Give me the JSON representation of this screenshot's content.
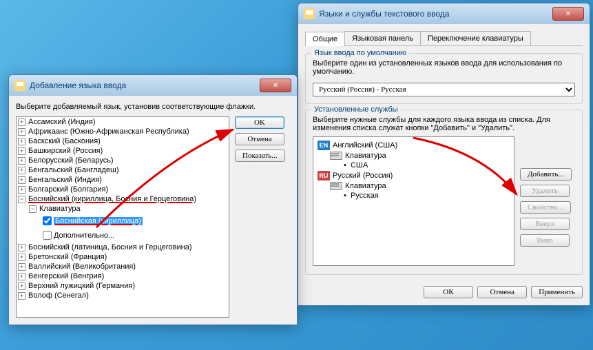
{
  "w1": {
    "title": "Добавление языка ввода",
    "instr": "Выберите добавляемый язык, установив соответствующие флажки.",
    "items": [
      "Ассамский (Индия)",
      "Африкаанс (Южно-Африканская Республика)",
      "Баскский (Баскония)",
      "Башкирский (Россия)",
      "Белорусский (Беларусь)",
      "Бенгальский (Бангладеш)",
      "Бенгальский (Индия)",
      "Болгарский (Болгария)"
    ],
    "open": "Боснийский (кириллица, Босния и Герцеговина)",
    "kb_lbl": "Клавиатура",
    "sel": "Боснийская (кириллица)",
    "extra": "Дополнительно...",
    "rest": [
      "Боснийский (латиница, Босния и Герцеговина)",
      "Бретонский (Франция)",
      "Валлийский (Великобритания)",
      "Венгерский (Венгрия)",
      "Верхний лужицкий (Германия)",
      "Волоф (Сенегал)"
    ],
    "ok": "OK",
    "cancel": "Отмена",
    "show": "Показать..."
  },
  "w2": {
    "title": "Языки и службы текстового ввода",
    "tabs": [
      "Общие",
      "Языковая панель",
      "Переключение клавиатуры"
    ],
    "fs1": {
      "legend": "Язык ввода по умолчанию",
      "text": "Выберите один из установленных языков ввода для использования по умолчанию.",
      "value": "Русский (Россия) - Русская"
    },
    "fs2": {
      "legend": "Установленные службы",
      "text": "Выберите нужные службы для каждого языка ввода из списка. Для изменения списка служат кнопки \"Добавить\" и \"Удалить\".",
      "en": "Английский (США)",
      "en_kb": "Клавиатура",
      "en_lay": "США",
      "ru": "Русский (Россия)",
      "ru_kb": "Клавиатура",
      "ru_lay": "Русская",
      "add": "Добавить...",
      "del": "Удалить",
      "prop": "Свойства...",
      "up": "Вверх",
      "down": "Вниз"
    },
    "ok": "OK",
    "cancel": "Отмена",
    "apply": "Применить"
  }
}
